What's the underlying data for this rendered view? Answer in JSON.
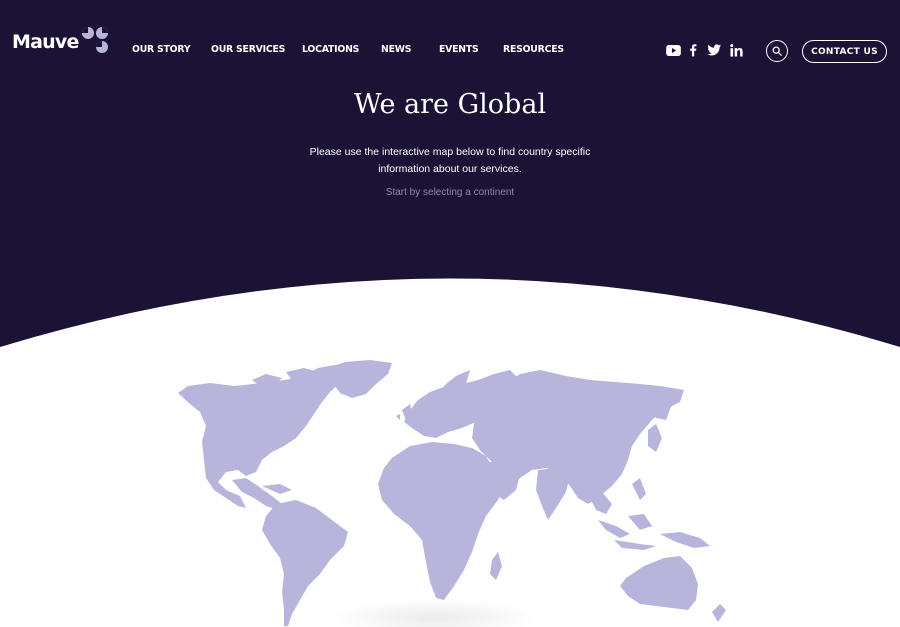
{
  "brand": {
    "name": "Mauve",
    "colors": {
      "primary": "#1b1236",
      "accent": "#b8b5dc",
      "text": "#ffffff"
    }
  },
  "nav": {
    "items": [
      {
        "label": "OUR STORY"
      },
      {
        "label": "OUR SERVICES"
      },
      {
        "label": "LOCATIONS"
      },
      {
        "label": "NEWS"
      },
      {
        "label": "EVENTS"
      },
      {
        "label": "RESOURCES"
      }
    ]
  },
  "social": {
    "icons": [
      "youtube-icon",
      "facebook-icon",
      "twitter-icon",
      "linkedin-icon"
    ]
  },
  "header": {
    "search_icon": "search-icon",
    "contact_label": "CONTACT US"
  },
  "hero": {
    "title": "We are Global",
    "description": "Please use the interactive map below to find country specific information about our services.",
    "prompt": "Start by selecting a continent",
    "prompt_icon": "chevron-down-icon"
  },
  "map": {
    "continents": [
      "North America",
      "South America",
      "Europe",
      "Africa",
      "Asia",
      "Oceania"
    ]
  }
}
